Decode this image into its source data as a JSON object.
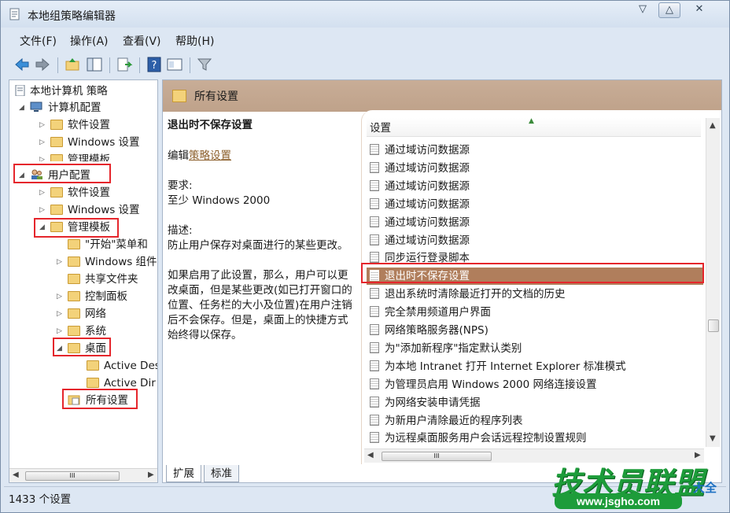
{
  "window": {
    "title": "本地组策略编辑器",
    "controls": {
      "minimize": "▽",
      "maximize": "△",
      "close": "✕"
    }
  },
  "menu": [
    "文件(F)",
    "操作(A)",
    "查看(V)",
    "帮助(H)"
  ],
  "toolbar": {
    "icons": [
      "back-arrow-icon",
      "forward-arrow-icon",
      "up-folder-icon",
      "show-hide-tree-icon",
      "export-list-icon",
      "help-icon",
      "properties-icon",
      "filter-icon"
    ]
  },
  "tree": {
    "root": "本地计算机 策略",
    "items": [
      {
        "label": "计算机配置",
        "level": 1
      },
      {
        "label": "软件设置",
        "level": 2
      },
      {
        "label": "Windows 设置",
        "level": 2
      },
      {
        "label": "管理模板",
        "level": 2
      },
      {
        "label": "用户配置",
        "level": 1
      },
      {
        "label": "软件设置",
        "level": 2
      },
      {
        "label": "Windows 设置",
        "level": 2
      },
      {
        "label": "管理模板",
        "level": 2
      },
      {
        "label": "\"开始\"菜单和",
        "level": 3
      },
      {
        "label": "Windows 组件",
        "level": 3
      },
      {
        "label": "共享文件夹",
        "level": 3
      },
      {
        "label": "控制面板",
        "level": 3
      },
      {
        "label": "网络",
        "level": 3
      },
      {
        "label": "系统",
        "level": 3
      },
      {
        "label": "桌面",
        "level": 3
      },
      {
        "label": "Active Des",
        "level": 4
      },
      {
        "label": "Active Dir",
        "level": 4
      },
      {
        "label": "所有设置",
        "level": 3
      }
    ],
    "scroll_thumb_label": "III"
  },
  "right": {
    "header_title": "所有设置",
    "description": {
      "title": "退出时不保存设置",
      "edit_prefix": "编辑",
      "edit_link": "策略设置",
      "requirement_label": "要求:",
      "requirement_value": "至少 Windows 2000",
      "description_label": "描述:",
      "description_text": "防止用户保存对桌面进行的某些更改。",
      "detail_text": "如果启用了此设置，那么，用户可以更改桌面，但是某些更改(如已打开窗口的位置、任务栏的大小及位置)在用户注销后不会保存。但是，桌面上的快捷方式始终得以保存。"
    },
    "list": {
      "column_header": "设置",
      "rows": [
        "通过域访问数据源",
        "通过域访问数据源",
        "通过域访问数据源",
        "通过域访问数据源",
        "通过域访问数据源",
        "通过域访问数据源",
        "同步运行登录脚本",
        "退出时不保存设置",
        "退出系统时清除最近打开的文档的历史",
        "完全禁用频道用户界面",
        "网络策略服务器(NPS)",
        "为\"添加新程序\"指定默认类别",
        "为本地 Intranet 打开 Internet Explorer 标准模式",
        "为管理员启用 Windows 2000 网络连接设置",
        "为网络安装申请凭据",
        "为新用户清除最近的程序列表",
        "为远程桌面服务用户会话远程控制设置规则"
      ],
      "selected_index": 7,
      "scroll_thumb_label": "III"
    },
    "tabs": [
      "扩展",
      "标准"
    ]
  },
  "status": {
    "text": "1433 个设置"
  },
  "watermark": {
    "brand": "技术员联盟",
    "small": "大全",
    "url": "www.jsgho.com"
  },
  "colors": {
    "accent_header": "#c4a68e",
    "selected_row": "#b07e5c",
    "highlight_box": "#e5262c",
    "watermark_green": "#1d9c3a"
  }
}
